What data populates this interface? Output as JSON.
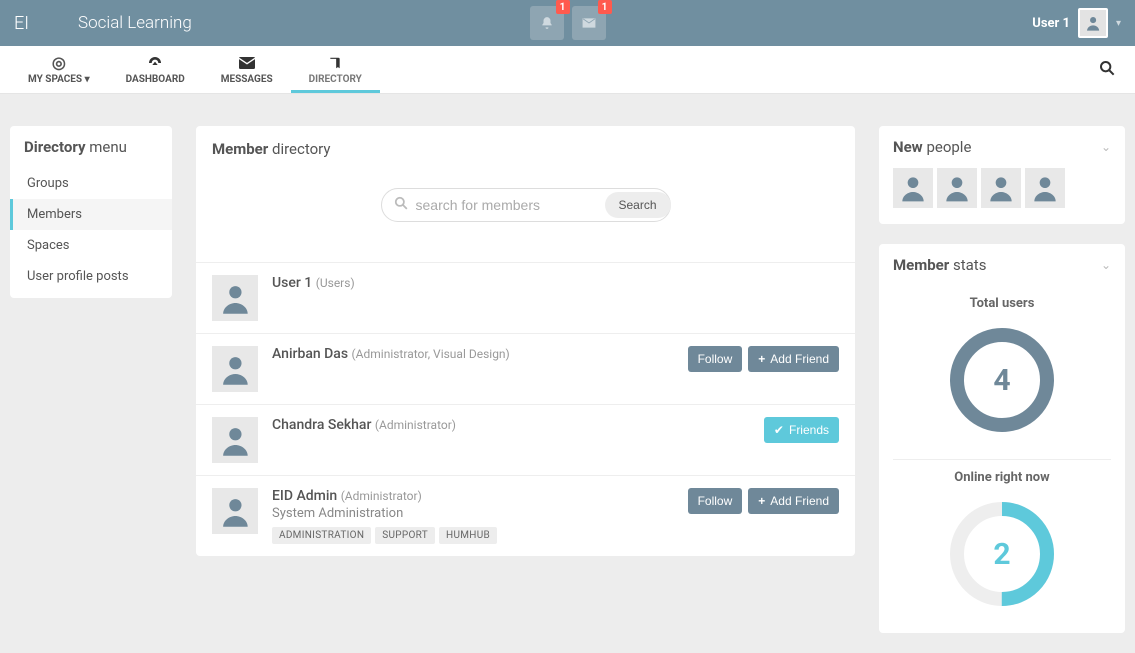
{
  "header": {
    "logo": "EI",
    "brand": "Social Learning",
    "notif_badge": "1",
    "mail_badge": "1",
    "username": "User 1"
  },
  "nav": {
    "myspaces": "MY SPACES",
    "dashboard": "DASHBOARD",
    "messages": "MESSAGES",
    "directory": "DIRECTORY"
  },
  "sidebar": {
    "title_strong": "Directory",
    "title_light": "menu",
    "items": [
      {
        "label": "Groups",
        "active": false
      },
      {
        "label": "Members",
        "active": true
      },
      {
        "label": "Spaces",
        "active": false
      },
      {
        "label": "User profile posts",
        "active": false
      }
    ]
  },
  "main": {
    "title_strong": "Member",
    "title_light": "directory",
    "search_placeholder": "search for members",
    "search_button": "Search",
    "follow_label": "Follow",
    "add_friend_label": "Add Friend",
    "friends_label": "Friends",
    "members": [
      {
        "name": "User 1",
        "meta": "(Users)",
        "sub": "",
        "tags": [],
        "actions": []
      },
      {
        "name": "Anirban Das",
        "meta": "(Administrator, Visual Design)",
        "sub": "",
        "tags": [],
        "actions": [
          "follow",
          "add"
        ]
      },
      {
        "name": "Chandra Sekhar",
        "meta": "(Administrator)",
        "sub": "",
        "tags": [],
        "actions": [
          "friends"
        ]
      },
      {
        "name": "EID Admin",
        "meta": "(Administrator)",
        "sub": "System Administration",
        "tags": [
          "ADMINISTRATION",
          "SUPPORT",
          "HUMHUB"
        ],
        "actions": [
          "follow",
          "add"
        ]
      }
    ]
  },
  "right": {
    "new_strong": "New",
    "new_light": "people",
    "new_people_count": 4,
    "stats_strong": "Member",
    "stats_light": "stats",
    "total_label": "Total users",
    "total_value": "4",
    "online_label": "Online right now",
    "online_value": "2",
    "online_fraction": 0.5
  },
  "colors": {
    "slate": "#708fa0",
    "teal": "#5ec9db",
    "ring_total": "#6f8899",
    "ring_online": "#5ec9db"
  }
}
